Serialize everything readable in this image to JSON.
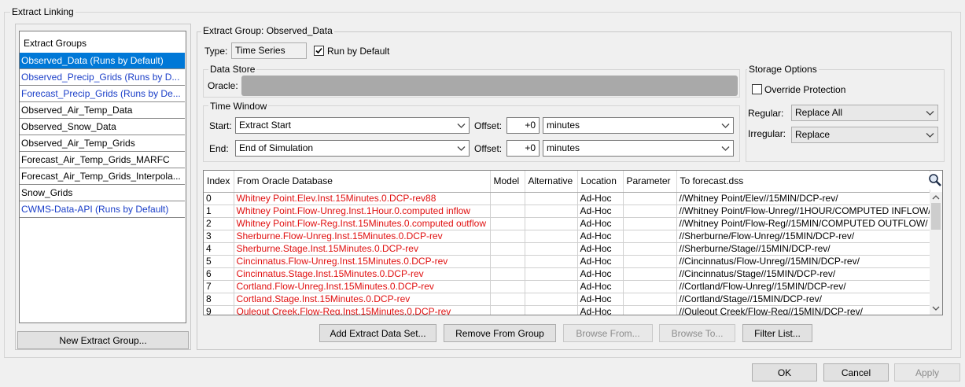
{
  "window": {
    "title": "Extract Linking"
  },
  "extract_groups": {
    "header": "Extract Groups",
    "items": [
      {
        "label": "Observed_Data (Runs by Default)",
        "style": "selected"
      },
      {
        "label": "Observed_Precip_Grids (Runs by D...",
        "style": "blue"
      },
      {
        "label": "Forecast_Precip_Grids (Runs by De...",
        "style": "blue"
      },
      {
        "label": "Observed_Air_Temp_Data",
        "style": "normal"
      },
      {
        "label": "Observed_Snow_Data",
        "style": "normal"
      },
      {
        "label": "Observed_Air_Temp_Grids",
        "style": "normal"
      },
      {
        "label": "Forecast_Air_Temp_Grids_MARFC",
        "style": "normal"
      },
      {
        "label": "Forecast_Air_Temp_Grids_Interpola...",
        "style": "normal"
      },
      {
        "label": "Snow_Grids",
        "style": "normal"
      },
      {
        "label": "CWMS-Data-API (Runs by Default)",
        "style": "blue"
      }
    ],
    "new_button": "New Extract Group..."
  },
  "group": {
    "title": "Extract Group: Observed_Data",
    "type_label": "Type:",
    "type_value": "Time Series",
    "run_by_default_label": "Run by Default",
    "run_by_default_checked": true
  },
  "data_store": {
    "title": "Data Store",
    "oracle_label": "Oracle:"
  },
  "time_window": {
    "title": "Time Window",
    "start_label": "Start:",
    "start_value": "Extract Start",
    "end_label": "End:",
    "end_value": "End of Simulation",
    "offset_label": "Offset:",
    "start_offset": "+0",
    "start_unit": "minutes",
    "end_offset": "+0",
    "end_unit": "minutes"
  },
  "storage": {
    "title": "Storage Options",
    "override_label": "Override Protection",
    "override_checked": false,
    "regular_label": "Regular:",
    "regular_value": "Replace All",
    "irregular_label": "Irregular:",
    "irregular_value": "Replace"
  },
  "table": {
    "columns": [
      "Index",
      "From Oracle Database",
      "Model",
      "Alternative",
      "Location",
      "Parameter",
      "To forecast.dss"
    ],
    "rows": [
      [
        "0",
        "Whitney Point.Elev.Inst.15Minutes.0.DCP-rev88",
        "",
        "",
        "Ad-Hoc",
        "",
        "//Whitney Point/Elev//15MIN/DCP-rev/"
      ],
      [
        "1",
        "Whitney Point.Flow-Unreg.Inst.1Hour.0.computed inflow",
        "",
        "",
        "Ad-Hoc",
        "",
        "//Whitney Point/Flow-Unreg//1HOUR/COMPUTED INFLOW/"
      ],
      [
        "2",
        "Whitney Point.Flow-Reg.Inst.15Minutes.0.computed outflow",
        "",
        "",
        "Ad-Hoc",
        "",
        "//Whitney Point/Flow-Reg//15MIN/COMPUTED OUTFLOW/"
      ],
      [
        "3",
        "Sherburne.Flow-Unreg.Inst.15Minutes.0.DCP-rev",
        "",
        "",
        "Ad-Hoc",
        "",
        "//Sherburne/Flow-Unreg//15MIN/DCP-rev/"
      ],
      [
        "4",
        "Sherburne.Stage.Inst.15Minutes.0.DCP-rev",
        "",
        "",
        "Ad-Hoc",
        "",
        "//Sherburne/Stage//15MIN/DCP-rev/"
      ],
      [
        "5",
        "Cincinnatus.Flow-Unreg.Inst.15Minutes.0.DCP-rev",
        "",
        "",
        "Ad-Hoc",
        "",
        "//Cincinnatus/Flow-Unreg//15MIN/DCP-rev/"
      ],
      [
        "6",
        "Cincinnatus.Stage.Inst.15Minutes.0.DCP-rev",
        "",
        "",
        "Ad-Hoc",
        "",
        "//Cincinnatus/Stage//15MIN/DCP-rev/"
      ],
      [
        "7",
        "Cortland.Flow-Unreg.Inst.15Minutes.0.DCP-rev",
        "",
        "",
        "Ad-Hoc",
        "",
        "//Cortland/Flow-Unreg//15MIN/DCP-rev/"
      ],
      [
        "8",
        "Cortland.Stage.Inst.15Minutes.0.DCP-rev",
        "",
        "",
        "Ad-Hoc",
        "",
        "//Cortland/Stage//15MIN/DCP-rev/"
      ],
      [
        "9",
        "Ouleout Creek.Flow-Reg.Inst.15Minutes.0.DCP-rev",
        "",
        "",
        "Ad-Hoc",
        "",
        "//Ouleout Creek/Flow-Reg//15MIN/DCP-rev/"
      ]
    ]
  },
  "actions": {
    "add": "Add Extract Data Set...",
    "remove": "Remove From Group",
    "browse_from": "Browse From...",
    "browse_to": "Browse To...",
    "filter": "Filter List..."
  },
  "dialog": {
    "ok": "OK",
    "cancel": "Cancel",
    "apply": "Apply"
  },
  "colors": {
    "selection": "#0078d7",
    "link_blue": "#1a3ec8",
    "error_red": "#e01010"
  },
  "icons": {
    "search": "magnifier-icon",
    "dropdown": "chevron-down-icon",
    "checkbox": "checkmark-icon"
  }
}
